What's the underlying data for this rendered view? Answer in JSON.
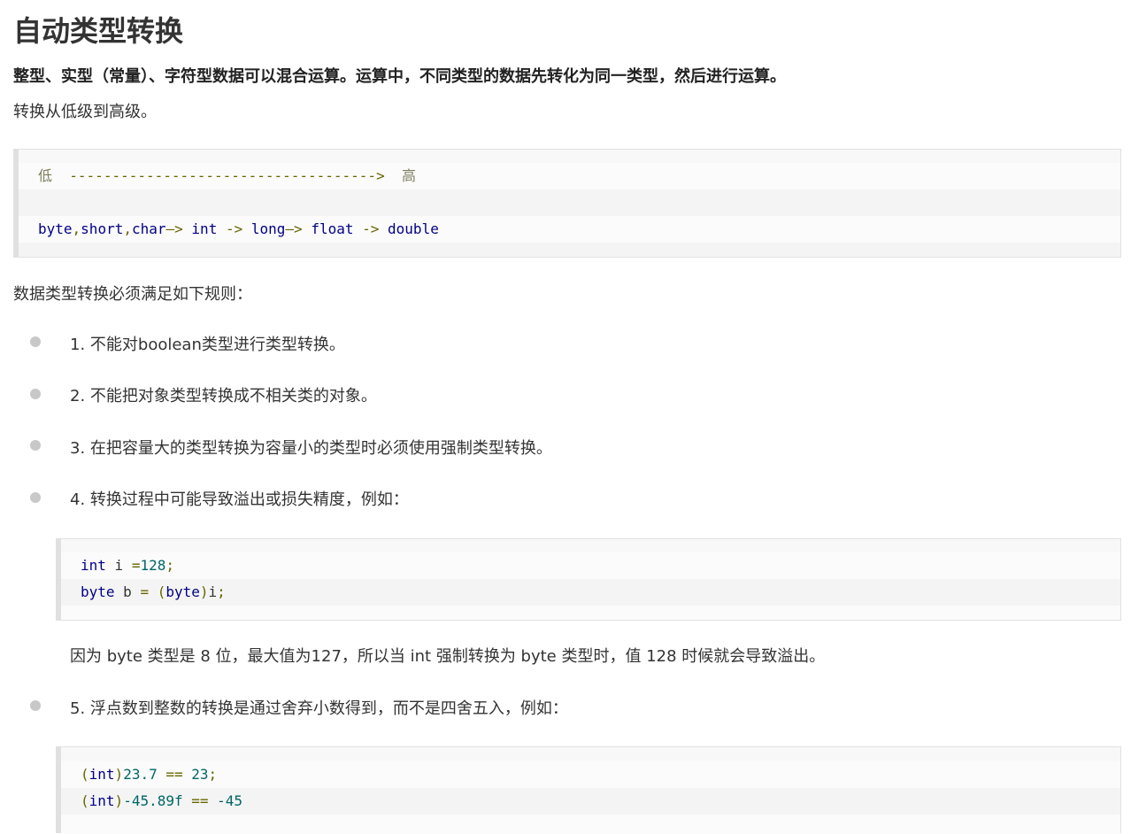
{
  "title": "自动类型转换",
  "lead": "整型、实型（常量）、字符型数据可以混合运算。运算中，不同类型的数据先转化为同一类型，然后进行运算。",
  "sub": "转换从低级到高级。",
  "order_code": {
    "low": "低",
    "dashes": "------------------------------------>",
    "high": "高",
    "t_byte": "byte",
    "comma1": ",",
    "t_short": "short",
    "comma2": ",",
    "t_char": "char",
    "a1": "—>",
    "t_int": "int",
    "a2": "->",
    "t_long": "long",
    "a3": "—>",
    "t_float": "float",
    "a4": "->",
    "t_double": "double"
  },
  "rules_intro": "数据类型转换必须满足如下规则：",
  "rules": [
    "1. 不能对boolean类型进行类型转换。",
    "2. 不能把对象类型转换成不相关类的对象。",
    "3. 在把容量大的类型转换为容量小的类型时必须使用强制类型转换。",
    "4. 转换过程中可能导致溢出或损失精度，例如：",
    "5. 浮点数到整数的转换是通过舍弃小数得到，而不是四舍五入，例如："
  ],
  "code_overflow": {
    "l1_kw": "int",
    "l1_var": " i ",
    "l1_op": "=",
    "l1_num": "128",
    "l1_end": ";",
    "l2_kw": "byte",
    "l2_var": " b ",
    "l2_op": "=",
    "l2_sp": " ",
    "l2_lp": "(",
    "l2_cast": "byte",
    "l2_rp": ")",
    "l2_i": "i",
    "l2_end": ";"
  },
  "overflow_note": "因为 byte 类型是 8 位，最大值为127，所以当 int 强制转换为 byte 类型时，值 128 时候就会导致溢出。",
  "code_float": {
    "l1_lp": "(",
    "l1_kw": "int",
    "l1_rp": ")",
    "l1_num": "23.7",
    "l1_op": " == ",
    "l1_res": "23",
    "l1_end": ";",
    "l2_lp": "(",
    "l2_kw": "int",
    "l2_rp": ")",
    "l2_num": "-45.89f",
    "l2_op": " == ",
    "l2_res": "-45"
  }
}
